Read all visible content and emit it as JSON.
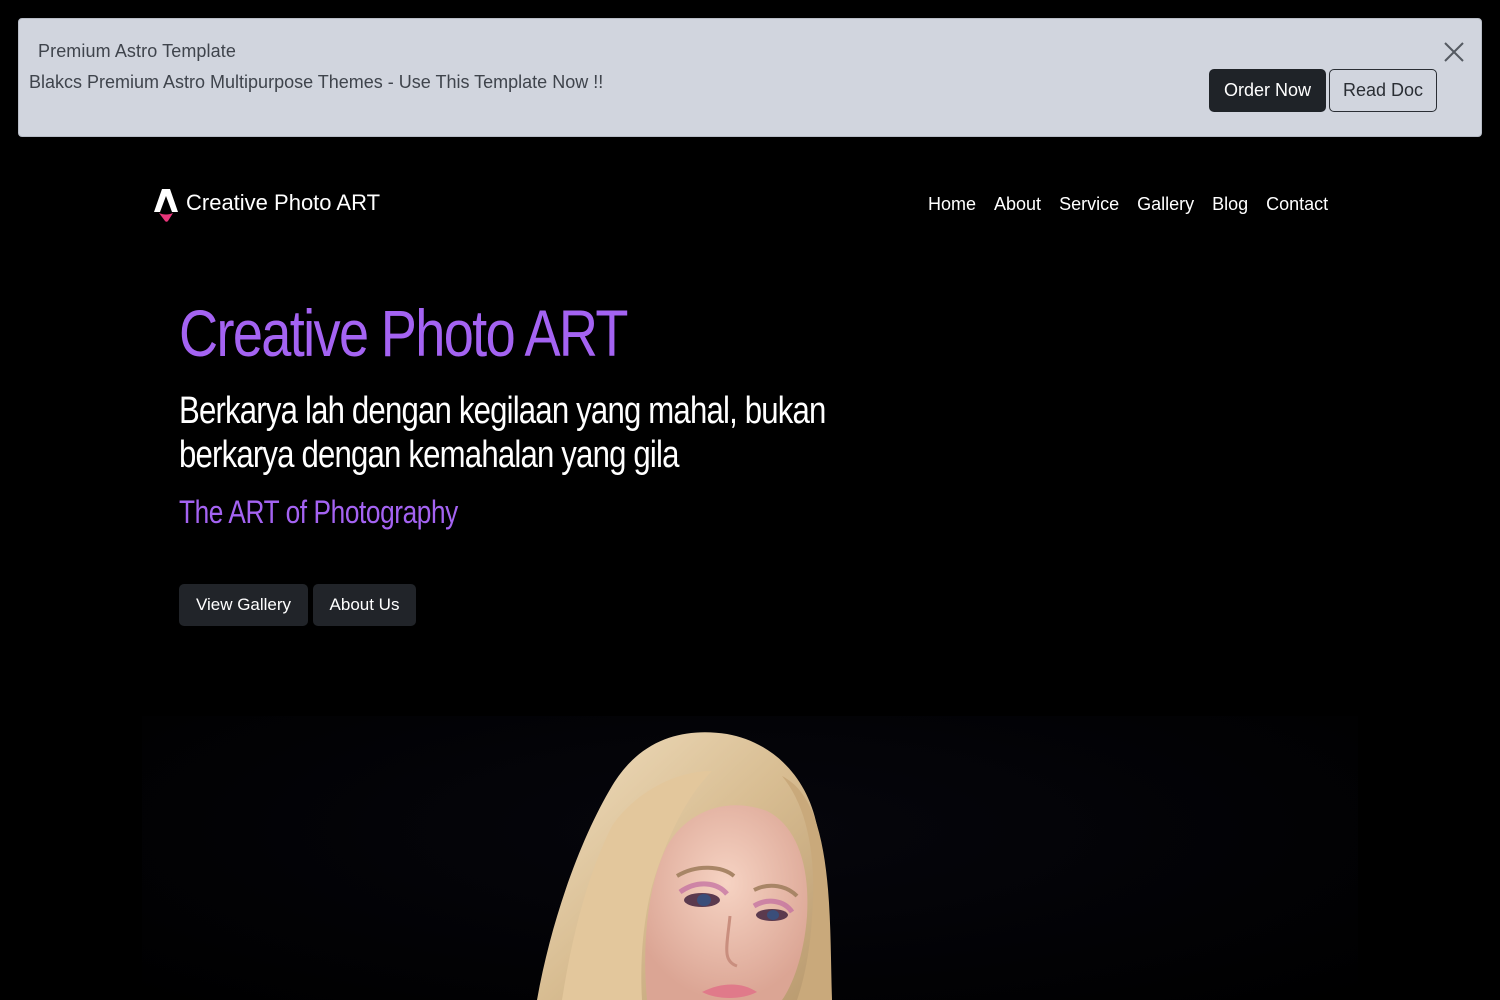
{
  "banner": {
    "title": "Premium Astro Template",
    "text": "Blakcs Premium Astro Multipurpose Themes - Use This Template Now !!",
    "order_label": "Order Now",
    "doc_label": "Read Doc",
    "close_icon": "close-icon"
  },
  "navbar": {
    "brand": "Creative Photo ART",
    "logo_icon": "astro-logo-icon",
    "links": [
      "Home",
      "About",
      "Service",
      "Gallery",
      "Blog",
      "Contact"
    ]
  },
  "hero": {
    "title": "Creative Photo ART",
    "subtitle": "Berkarya lah dengan kegilaan yang mahal, bukan berkarya dengan kemahalan yang gila",
    "tagline": "The ART of Photography",
    "gallery_button": "View Gallery",
    "about_button": "About Us"
  },
  "colors": {
    "accent": "#a463f2",
    "background": "#000000",
    "banner_bg": "#d1d5de",
    "button_dark": "#212429"
  }
}
